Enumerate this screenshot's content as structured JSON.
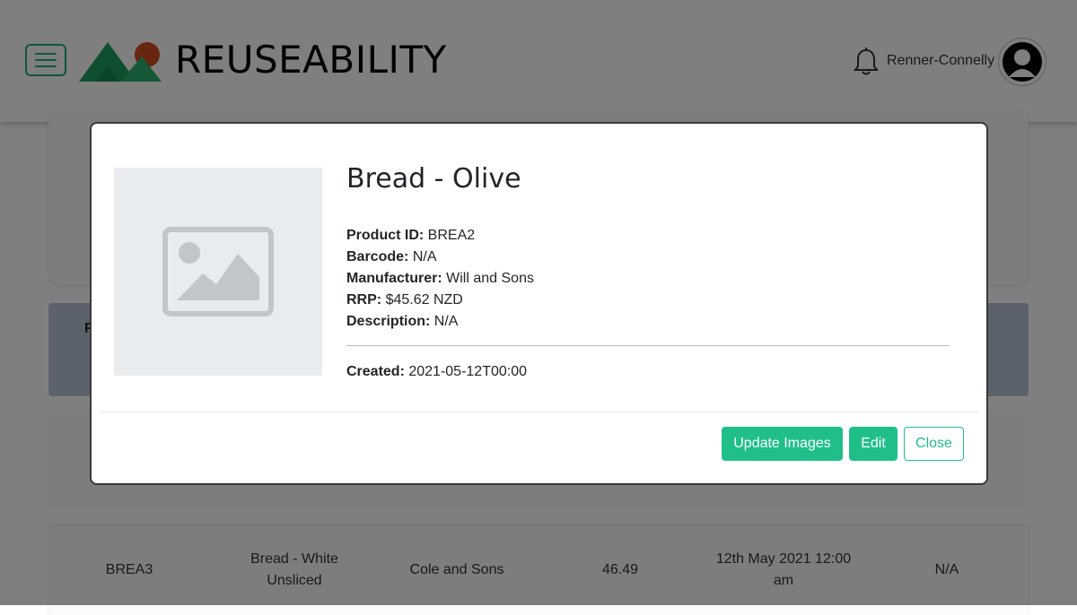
{
  "app": {
    "brand": "REUSEABILITY"
  },
  "header": {
    "username": "Renner-Connelly"
  },
  "background": {
    "banner_letter": "F",
    "row": {
      "product_id": "BREA3",
      "name": "Bread - White Unsliced",
      "manufacturer": "Cole and Sons",
      "rrp": "46.49",
      "created": "12th May 2021 12:00 am",
      "barcode": "N/A"
    }
  },
  "modal": {
    "title": "Bread - Olive",
    "fields": {
      "product_id_label": "Product ID:",
      "product_id": "BREA2",
      "barcode_label": "Barcode:",
      "barcode": "N/A",
      "manufacturer_label": "Manufacturer:",
      "manufacturer": "Will and Sons",
      "rrp_label": "RRP:",
      "rrp": "$45.62 NZD",
      "description_label": "Description:",
      "description": "N/A",
      "created_label": "Created:",
      "created": "2021-05-12T00:00"
    },
    "buttons": {
      "update_images": "Update Images",
      "edit": "Edit",
      "close": "Close"
    }
  },
  "icons": {
    "menu": "hamburger-menu-icon",
    "logo": "mountain-sun-logo",
    "bell": "bell-icon",
    "avatar": "user-silhouette-icon",
    "image": "image-placeholder-icon"
  },
  "colors": {
    "accent": "#20bf8a",
    "overlay": "rgba(0,0,0,0.5)",
    "banner": "#b7c4d8"
  }
}
